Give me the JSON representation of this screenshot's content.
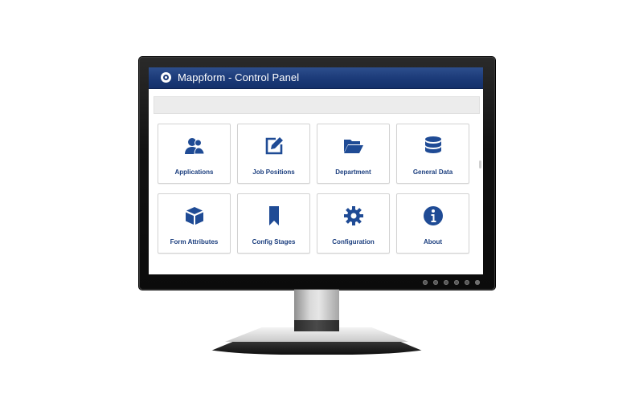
{
  "window": {
    "title": "Mappform - Control Panel"
  },
  "tiles": [
    {
      "label": "Applications",
      "icon": "users-icon"
    },
    {
      "label": "Job Positions",
      "icon": "edit-icon"
    },
    {
      "label": "Department",
      "icon": "folder-open-icon"
    },
    {
      "label": "General Data",
      "icon": "database-icon"
    },
    {
      "label": "Form Attributes",
      "icon": "cube-icon"
    },
    {
      "label": "Config Stages",
      "icon": "bookmark-icon"
    },
    {
      "label": "Configuration",
      "icon": "gear-icon"
    },
    {
      "label": "About",
      "icon": "info-icon"
    }
  ],
  "colors": {
    "accent": "#1c3f7f",
    "titlebar": "#1b3a78",
    "icon": "#1f4b95"
  }
}
